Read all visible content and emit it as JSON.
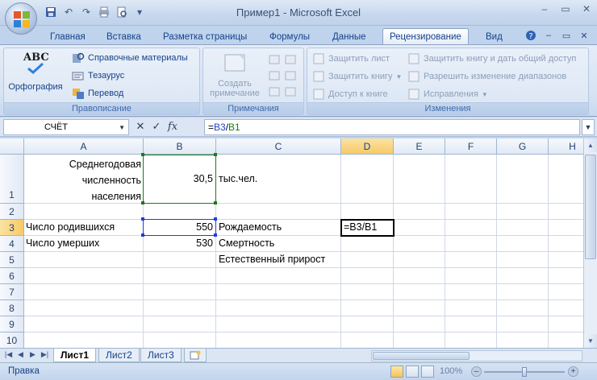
{
  "window": {
    "title": "Пример1 - Microsoft Excel",
    "minimize": "–",
    "restore": "▭",
    "close": "✕"
  },
  "qat": {
    "undo": "↶",
    "redo": "↷",
    "customize": "▾"
  },
  "tabs": [
    {
      "label": "Главная",
      "active": false
    },
    {
      "label": "Вставка",
      "active": false
    },
    {
      "label": "Разметка страницы",
      "active": false
    },
    {
      "label": "Формулы",
      "active": false
    },
    {
      "label": "Данные",
      "active": false
    },
    {
      "label": "Рецензирование",
      "active": true
    },
    {
      "label": "Вид",
      "active": false
    }
  ],
  "ribbon": {
    "proofing": {
      "label": "Правописание",
      "spelling": "Орфография",
      "spelling_icon_text": "ABC",
      "research": "Справочные материалы",
      "thesaurus": "Тезаурус",
      "translate": "Перевод"
    },
    "comments": {
      "label": "Примечания",
      "new_comment_line1": "Создать",
      "new_comment_line2": "примечание"
    },
    "changes": {
      "label": "Изменения",
      "protect_sheet": "Защитить лист",
      "protect_workbook": "Защитить книгу",
      "share_workbook": "Доступ к книге",
      "protect_and_share": "Защитить книгу и дать общий доступ",
      "allow_edit_ranges": "Разрешить изменение диапазонов",
      "track_changes": "Исправления"
    }
  },
  "formula_bar": {
    "name_box": "СЧЁТ",
    "cancel": "✕",
    "enter": "✓",
    "fx": "fx",
    "formula_ref1": "B3",
    "formula_op": "/",
    "formula_ref2": "B1",
    "formula_prefix": "=",
    "ref1_color": "#1f3fd6",
    "ref2_color": "#1b7a1b"
  },
  "columns": [
    "A",
    "B",
    "C",
    "D",
    "E",
    "F",
    "G",
    "H"
  ],
  "rows": [
    "1",
    "2",
    "3",
    "4",
    "5",
    "6",
    "7",
    "8",
    "9",
    "10"
  ],
  "cells": {
    "A1_line1": "Среднегодовая",
    "A1_line2": "численность",
    "A1_line3": "населения",
    "B1": "30,5",
    "C1": "тыс.чел.",
    "A3": "Число родившихся",
    "B3": "550",
    "C3": "Рождаемость",
    "D3": "=B3/B1",
    "A4": "Число умерших",
    "B4": "530",
    "C4": "Смертность",
    "C5": "Естественный прирост"
  },
  "sheets": [
    {
      "label": "Лист1",
      "active": true
    },
    {
      "label": "Лист2",
      "active": false
    },
    {
      "label": "Лист3",
      "active": false
    }
  ],
  "status": {
    "mode": "Правка",
    "zoom": "100%",
    "zoom_level_percent": 100,
    "zoom_minus": "–",
    "zoom_plus": "+"
  }
}
